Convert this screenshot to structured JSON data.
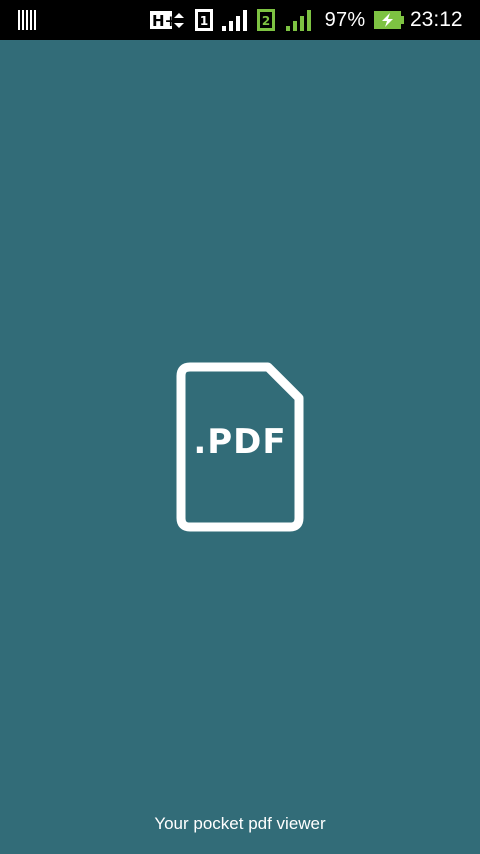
{
  "status_bar": {
    "network_type": "H+",
    "sim1_label": "1",
    "sim2_label": "2",
    "battery_percent": "97%",
    "time": "23:12",
    "icons": [
      "barcode-icon",
      "hplus-data-icon",
      "sim1-icon",
      "signal-strength-icon",
      "sim2-icon",
      "signal-strength-icon",
      "battery-charging-icon"
    ]
  },
  "splash": {
    "logo_text": ".PDF",
    "tagline": "Your pocket pdf viewer",
    "colors": {
      "background": "#326c78",
      "foreground": "#ffffff",
      "sim2_accent": "#7dc242",
      "battery_accent": "#7dc242"
    }
  }
}
